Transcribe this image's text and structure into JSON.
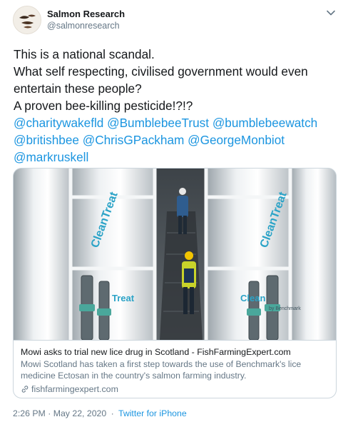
{
  "author": {
    "name": "Salmon Research",
    "handle": "@salmonresearch"
  },
  "tweet": {
    "lines": [
      "This is a national scandal.",
      "What self respecting, civilised government would even",
      "entertain these people?",
      "A proven bee-killing pesticide!?!?"
    ],
    "mentions": [
      "@charitywakefld",
      "@BumblebeeTrust",
      "@bumblebeewatch",
      "@britishbee",
      "@ChrisGPackham",
      "@GeorgeMonbiot",
      "@markruskell"
    ]
  },
  "card": {
    "title": "Mowi asks to trial new lice drug in Scotland - FishFarmingExpert.com",
    "description": "Mowi Scotland has taken a first step towards the use of Benchmark's lice medicine Ectosan in the country's salmon farming industry.",
    "domain": "fishfarmingexpert.com",
    "image_text": {
      "tank_label_left": "CleanTreat",
      "tank_label_right": "CleanTreat",
      "tank_brand_small": "by Benchmark",
      "treat_left": "Treat",
      "treat_right": "Clean"
    }
  },
  "footer": {
    "time": "2:26 PM · May 22, 2020",
    "separator": "·",
    "source": "Twitter for iPhone"
  },
  "colors": {
    "link": "#1b95e0",
    "text": "#14171a",
    "muted": "#657786",
    "border": "#ccd6dd"
  },
  "icons": {
    "caret": "chevron-down-icon",
    "link": "link-icon"
  }
}
